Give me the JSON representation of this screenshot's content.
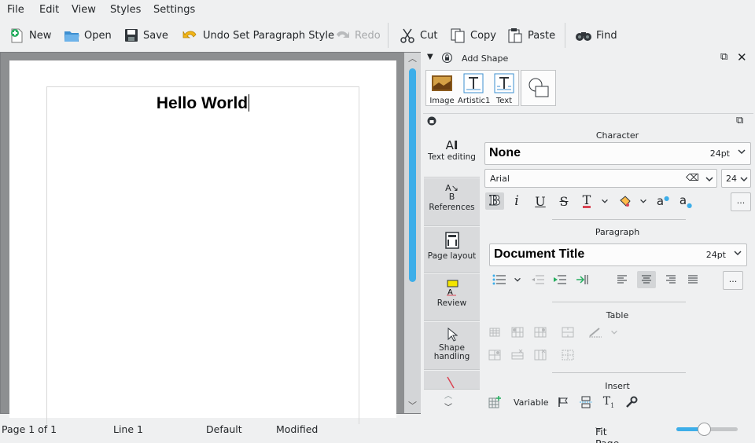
{
  "menu": {
    "items": [
      "File",
      "Edit",
      "View",
      "Styles",
      "Settings"
    ]
  },
  "toolbar": {
    "new_label": "New",
    "open_label": "Open",
    "save_label": "Save",
    "undo_label": "Undo Set Paragraph Style",
    "redo_label": "Redo",
    "cut_label": "Cut",
    "copy_label": "Copy",
    "paste_label": "Paste",
    "find_label": "Find"
  },
  "document": {
    "text": "Hello World"
  },
  "add_shape": {
    "title": "Add Shape",
    "items": [
      "Image",
      "Artistic1",
      "Text"
    ]
  },
  "tool_tabs": [
    "Text editing",
    "References",
    "Page layout",
    "Review",
    "Shape handling"
  ],
  "character": {
    "title": "Character",
    "style": "None",
    "style_size": "24pt",
    "font": "Arial",
    "size": "24"
  },
  "paragraph": {
    "title": "Paragraph",
    "style": "Document Title",
    "style_size": "24pt"
  },
  "table": {
    "title": "Table"
  },
  "insert": {
    "title": "Insert",
    "variable_label": "Variable"
  },
  "more_label": "...",
  "status": {
    "page": "Page 1 of 1",
    "line": "Line 1",
    "style": "Default",
    "state": "Modified",
    "zoom": "Fit Page Width",
    "zoom_slider_fraction": 0.45
  },
  "colors": {
    "accent": "#3daee9",
    "bg": "#eff0f1"
  }
}
